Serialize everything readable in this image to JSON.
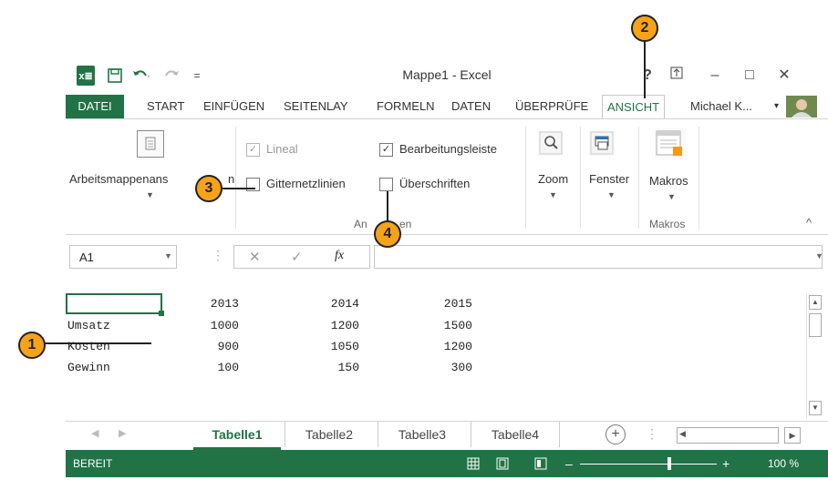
{
  "window": {
    "title": "Mappe1 - Excel",
    "qat": {
      "excel_logo": "x≣",
      "save": "save-icon",
      "undo": "undo-icon",
      "redo": "redo-icon",
      "customize": "="
    },
    "controls": {
      "help": "?",
      "ribbon_options": "ribbon-options-icon",
      "minimize": "–",
      "maximize": "□",
      "close": "✕"
    }
  },
  "tabs": [
    "DATEI",
    "START",
    "EINFÜGEN",
    "SEITENLAY",
    "FORMELN",
    "DATEN",
    "ÜBERPRÜFE",
    "ANSICHT"
  ],
  "active_tab": "ANSICHT",
  "user": {
    "name": "Michael K...",
    "chevron": "▾"
  },
  "ribbon": {
    "workbook_views": "Arbeitsmappenans",
    "workbook_views_suffix": "n",
    "show": {
      "ruler": {
        "label": "Lineal",
        "checked": true,
        "disabled": true
      },
      "formula_bar": {
        "label": "Bearbeitungsleiste",
        "checked": true
      },
      "gridlines": {
        "label": "Gitternetzlinien",
        "checked": false
      },
      "headings": {
        "label": "Überschriften",
        "checked": false
      },
      "group_label_left": "An",
      "group_label_right": "en"
    },
    "zoom": "Zoom",
    "window": "Fenster",
    "macros_button": "Makros",
    "macros_group": "Makros",
    "collapse": "^"
  },
  "formula_bar": {
    "name_box": "A1",
    "cancel": "✕",
    "enter": "✓",
    "fx": "fx",
    "value": ""
  },
  "sheet": {
    "header_row": [
      "",
      "2013",
      "2014",
      "2015"
    ],
    "rows": [
      {
        "label": "Umsatz",
        "values": [
          "1000",
          "1200",
          "1500"
        ]
      },
      {
        "label": "Kosten",
        "values": [
          "900",
          "1050",
          "1200"
        ]
      },
      {
        "label": "Gewinn",
        "values": [
          "100",
          "150",
          "300"
        ]
      }
    ]
  },
  "sheet_tabs": [
    "Tabelle1",
    "Tabelle2",
    "Tabelle3",
    "Tabelle4"
  ],
  "active_sheet": "Tabelle1",
  "status": {
    "ready": "BEREIT",
    "zoom": "100 %",
    "zoom_minus": "–",
    "zoom_plus": "+"
  },
  "callouts": [
    "1",
    "2",
    "3",
    "4"
  ],
  "colors": {
    "accent": "#217346",
    "callout": "#f6a31a"
  }
}
